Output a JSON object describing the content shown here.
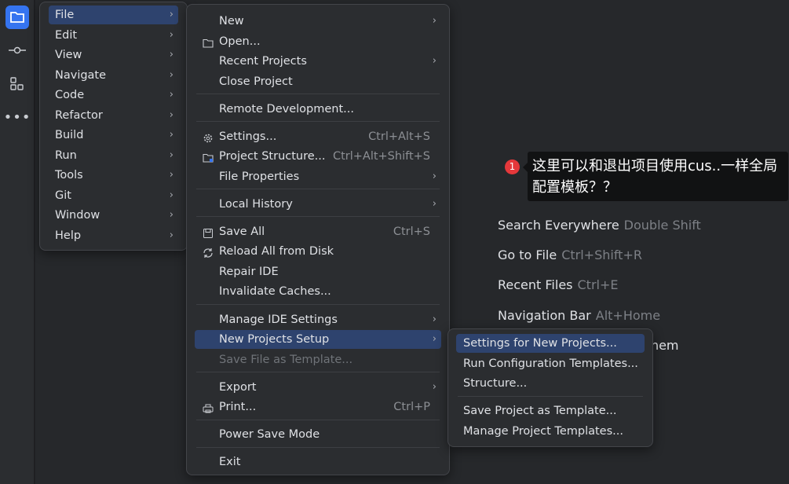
{
  "sidebar": {
    "icons": [
      "folder-icon",
      "commit-icon",
      "structure-icon",
      "more-icon"
    ]
  },
  "menubar": {
    "items": [
      {
        "label": "File",
        "highlighted": true
      },
      {
        "label": "Edit"
      },
      {
        "label": "View"
      },
      {
        "label": "Navigate"
      },
      {
        "label": "Code"
      },
      {
        "label": "Refactor"
      },
      {
        "label": "Build"
      },
      {
        "label": "Run"
      },
      {
        "label": "Tools"
      },
      {
        "label": "Git"
      },
      {
        "label": "Window"
      },
      {
        "label": "Help"
      }
    ]
  },
  "file_menu": {
    "items": [
      {
        "label": "New",
        "submenu": true
      },
      {
        "label": "Open...",
        "icon": "folder-icon"
      },
      {
        "label": "Recent Projects",
        "submenu": true
      },
      {
        "label": "Close Project"
      },
      {
        "sep": true
      },
      {
        "label": "Remote Development..."
      },
      {
        "sep": true
      },
      {
        "label": "Settings...",
        "icon": "gear-icon",
        "shortcut": "Ctrl+Alt+S"
      },
      {
        "label": "Project Structure...",
        "icon": "project-structure-icon",
        "shortcut": "Ctrl+Alt+Shift+S"
      },
      {
        "label": "File Properties",
        "submenu": true
      },
      {
        "sep": true
      },
      {
        "label": "Local History",
        "submenu": true
      },
      {
        "sep": true
      },
      {
        "label": "Save All",
        "icon": "save-icon",
        "shortcut": "Ctrl+S"
      },
      {
        "label": "Reload All from Disk",
        "icon": "reload-icon"
      },
      {
        "label": "Repair IDE"
      },
      {
        "label": "Invalidate Caches..."
      },
      {
        "sep": true
      },
      {
        "label": "Manage IDE Settings",
        "submenu": true
      },
      {
        "label": "New Projects Setup",
        "submenu": true,
        "highlighted": true
      },
      {
        "label": "Save File as Template...",
        "disabled": true
      },
      {
        "sep": true
      },
      {
        "label": "Export",
        "submenu": true
      },
      {
        "label": "Print...",
        "icon": "print-icon",
        "shortcut": "Ctrl+P"
      },
      {
        "sep": true
      },
      {
        "label": "Power Save Mode"
      },
      {
        "sep": true
      },
      {
        "label": "Exit"
      }
    ]
  },
  "setup_submenu": {
    "items": [
      {
        "label": "Settings for New Projects...",
        "highlighted": true
      },
      {
        "label": "Run Configuration Templates..."
      },
      {
        "label": "Structure..."
      },
      {
        "sep": true
      },
      {
        "label": "Save Project as Template..."
      },
      {
        "label": "Manage Project Templates..."
      }
    ]
  },
  "welcome_hints": [
    {
      "label": "Search Everywhere",
      "key": "Double Shift"
    },
    {
      "label": "Go to File",
      "key": "Ctrl+Shift+R"
    },
    {
      "label": "Recent Files",
      "key": "Ctrl+E"
    },
    {
      "label": "Navigation Bar",
      "key": "Alt+Home"
    },
    {
      "label": "Drop files here to open them",
      "key": ""
    }
  ],
  "annotation": {
    "number": "1",
    "text": "这里可以和退出项目使用cus..一样全局配置模板？？"
  },
  "colors": {
    "accent": "#3574f0",
    "highlight": "#2e436e",
    "badge": "#e5383b"
  }
}
